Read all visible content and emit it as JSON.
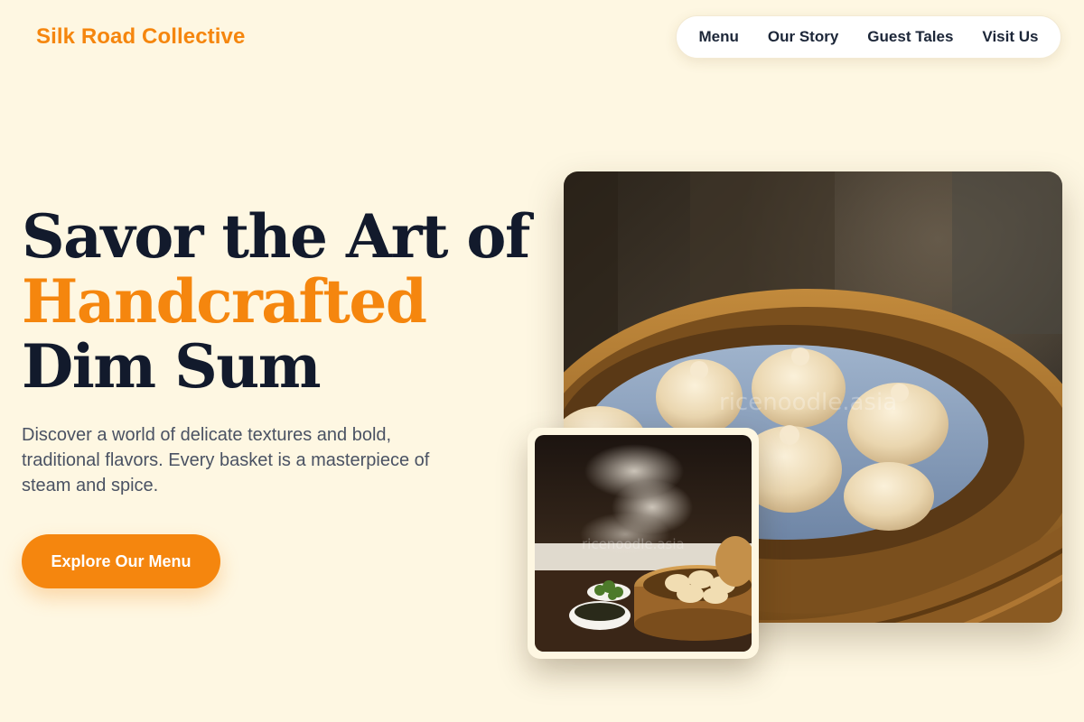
{
  "header": {
    "brand": "Silk Road Collective",
    "nav": [
      "Menu",
      "Our Story",
      "Guest Tales",
      "Visit Us"
    ]
  },
  "hero": {
    "title_line1": "Savor the Art of",
    "title_accent": "Handcrafted",
    "title_line3": "Dim Sum",
    "description": "Discover a world of delicate textures and bold, traditional flavors. Every basket is a masterpiece of steam and spice.",
    "cta_label": "Explore Our Menu"
  },
  "images": {
    "main": {
      "subject": "soup dumplings in bamboo steamer",
      "watermark": "ricenoodle.asia"
    },
    "secondary": {
      "subject": "steaming dim sum basket with dipping sauce",
      "watermark": "ricenoodle.asia"
    }
  },
  "colors": {
    "background": "#fef7e2",
    "accent": "#f5860e",
    "heading": "#121a2c",
    "body_text": "#4a5263"
  }
}
